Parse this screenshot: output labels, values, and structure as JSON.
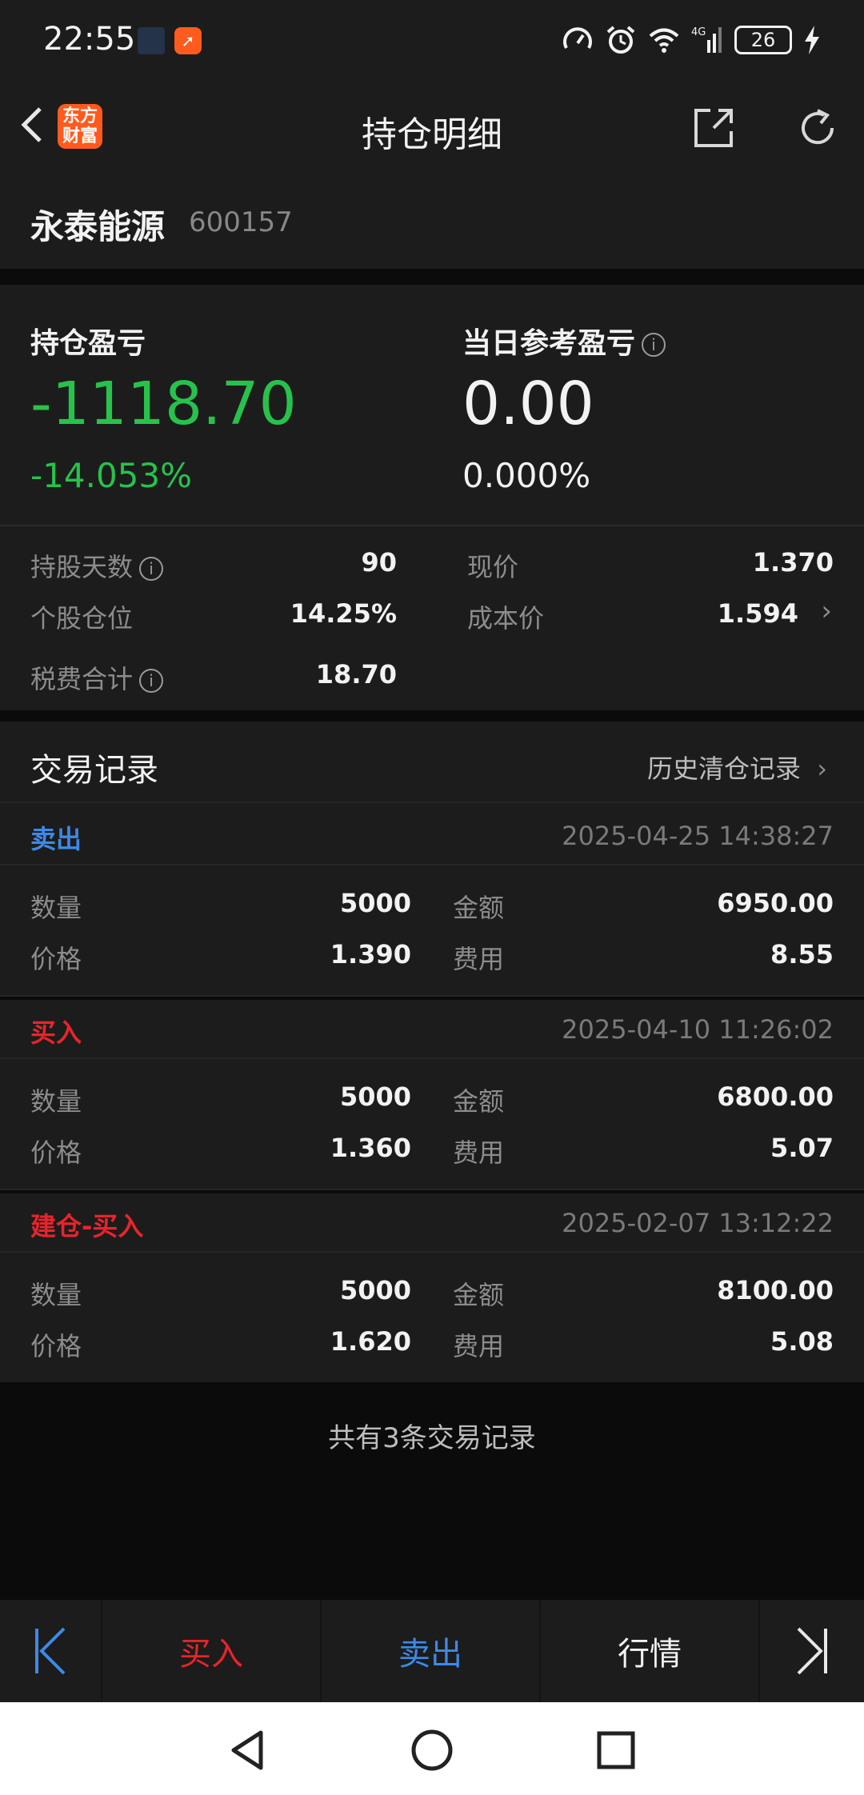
{
  "status_bar": {
    "time": "22:55",
    "network": "4G",
    "battery": "26",
    "icons": [
      "speed-icon",
      "alarm-icon",
      "wifi-icon",
      "signal-icon",
      "battery-icon",
      "charging-icon"
    ]
  },
  "nav": {
    "logo_line1": "东方",
    "logo_line2": "财富",
    "title": "持仓明细"
  },
  "stock": {
    "name": "永泰能源",
    "code": "600157"
  },
  "summary": {
    "holding_pl_label": "持仓盈亏",
    "holding_pl_value": "-1118.70",
    "holding_pl_pct": "-14.053%",
    "daily_pl_label": "当日参考盈亏",
    "daily_pl_value": "0.00",
    "daily_pl_pct": "0.000%",
    "stats": {
      "days_label": "持股天数",
      "days_value": "90",
      "price_label": "现价",
      "price_value": "1.370",
      "position_label": "个股仓位",
      "position_value": "14.25%",
      "cost_label": "成本价",
      "cost_value": "1.594",
      "fee_label": "税费合计",
      "fee_value": "18.70"
    },
    "colors": {
      "loss": "#27c24c"
    }
  },
  "trades": {
    "title": "交易记录",
    "history_link": "历史清仓记录",
    "labels": {
      "qty": "数量",
      "amount": "金额",
      "price": "价格",
      "fee": "费用"
    },
    "records": [
      {
        "type": "卖出",
        "time": "2025-04-25 14:38:27",
        "qty": "5000",
        "amount": "6950.00",
        "price": "1.390",
        "fee": "8.55",
        "color": "#3d8ae6"
      },
      {
        "type": "买入",
        "time": "2025-04-10 11:26:02",
        "qty": "5000",
        "amount": "6800.00",
        "price": "1.360",
        "fee": "5.07",
        "color": "#e8242b"
      },
      {
        "type": "建仓-买入",
        "time": "2025-02-07 13:12:22",
        "qty": "5000",
        "amount": "8100.00",
        "price": "1.620",
        "fee": "5.08",
        "color": "#e8242b"
      }
    ],
    "footer": "共有3条交易记录"
  },
  "bottom_bar": {
    "buy": "买入",
    "sell": "卖出",
    "quote": "行情"
  }
}
